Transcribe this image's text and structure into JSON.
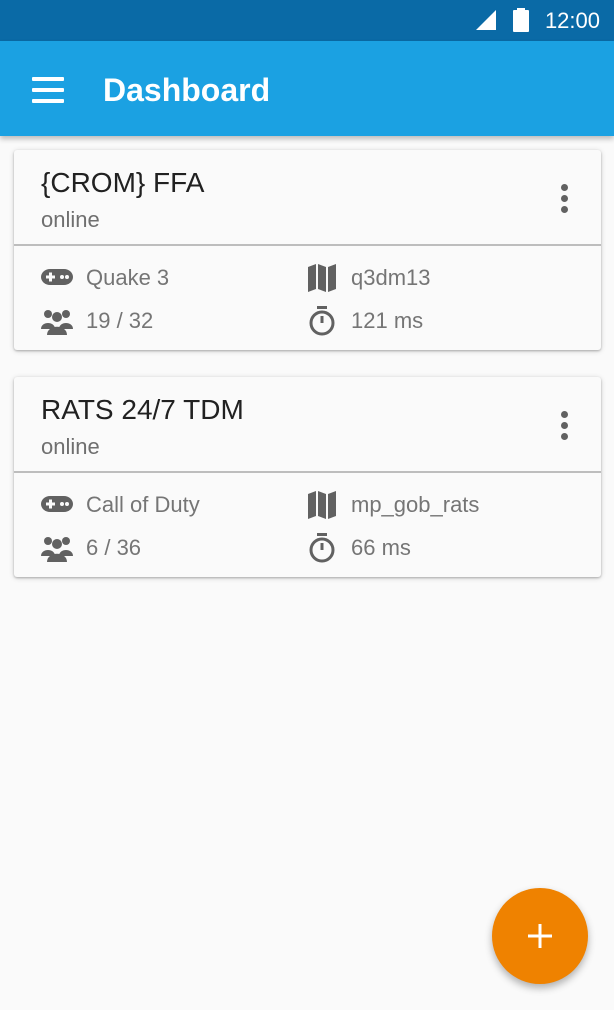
{
  "status_bar": {
    "time": "12:00",
    "icons": [
      "signal-icon",
      "battery-icon"
    ]
  },
  "app_bar": {
    "title": "Dashboard",
    "nav_icon": "menu-icon"
  },
  "servers": [
    {
      "name": "{CROM} FFA",
      "status": "online",
      "game": "Quake 3",
      "map": "q3dm13",
      "players": "19 / 32",
      "ping": "121 ms"
    },
    {
      "name": "RATS 24/7 TDM",
      "status": "online",
      "game": "Call of Duty",
      "map": "mp_gob_rats",
      "players": "6 / 36",
      "ping": "66 ms"
    }
  ],
  "fab": {
    "icon": "plus-icon"
  },
  "colors": {
    "status_bar": "#0a6aa6",
    "app_bar": "#1ba1e2",
    "fab": "#ef8200",
    "background": "#fafafa"
  }
}
